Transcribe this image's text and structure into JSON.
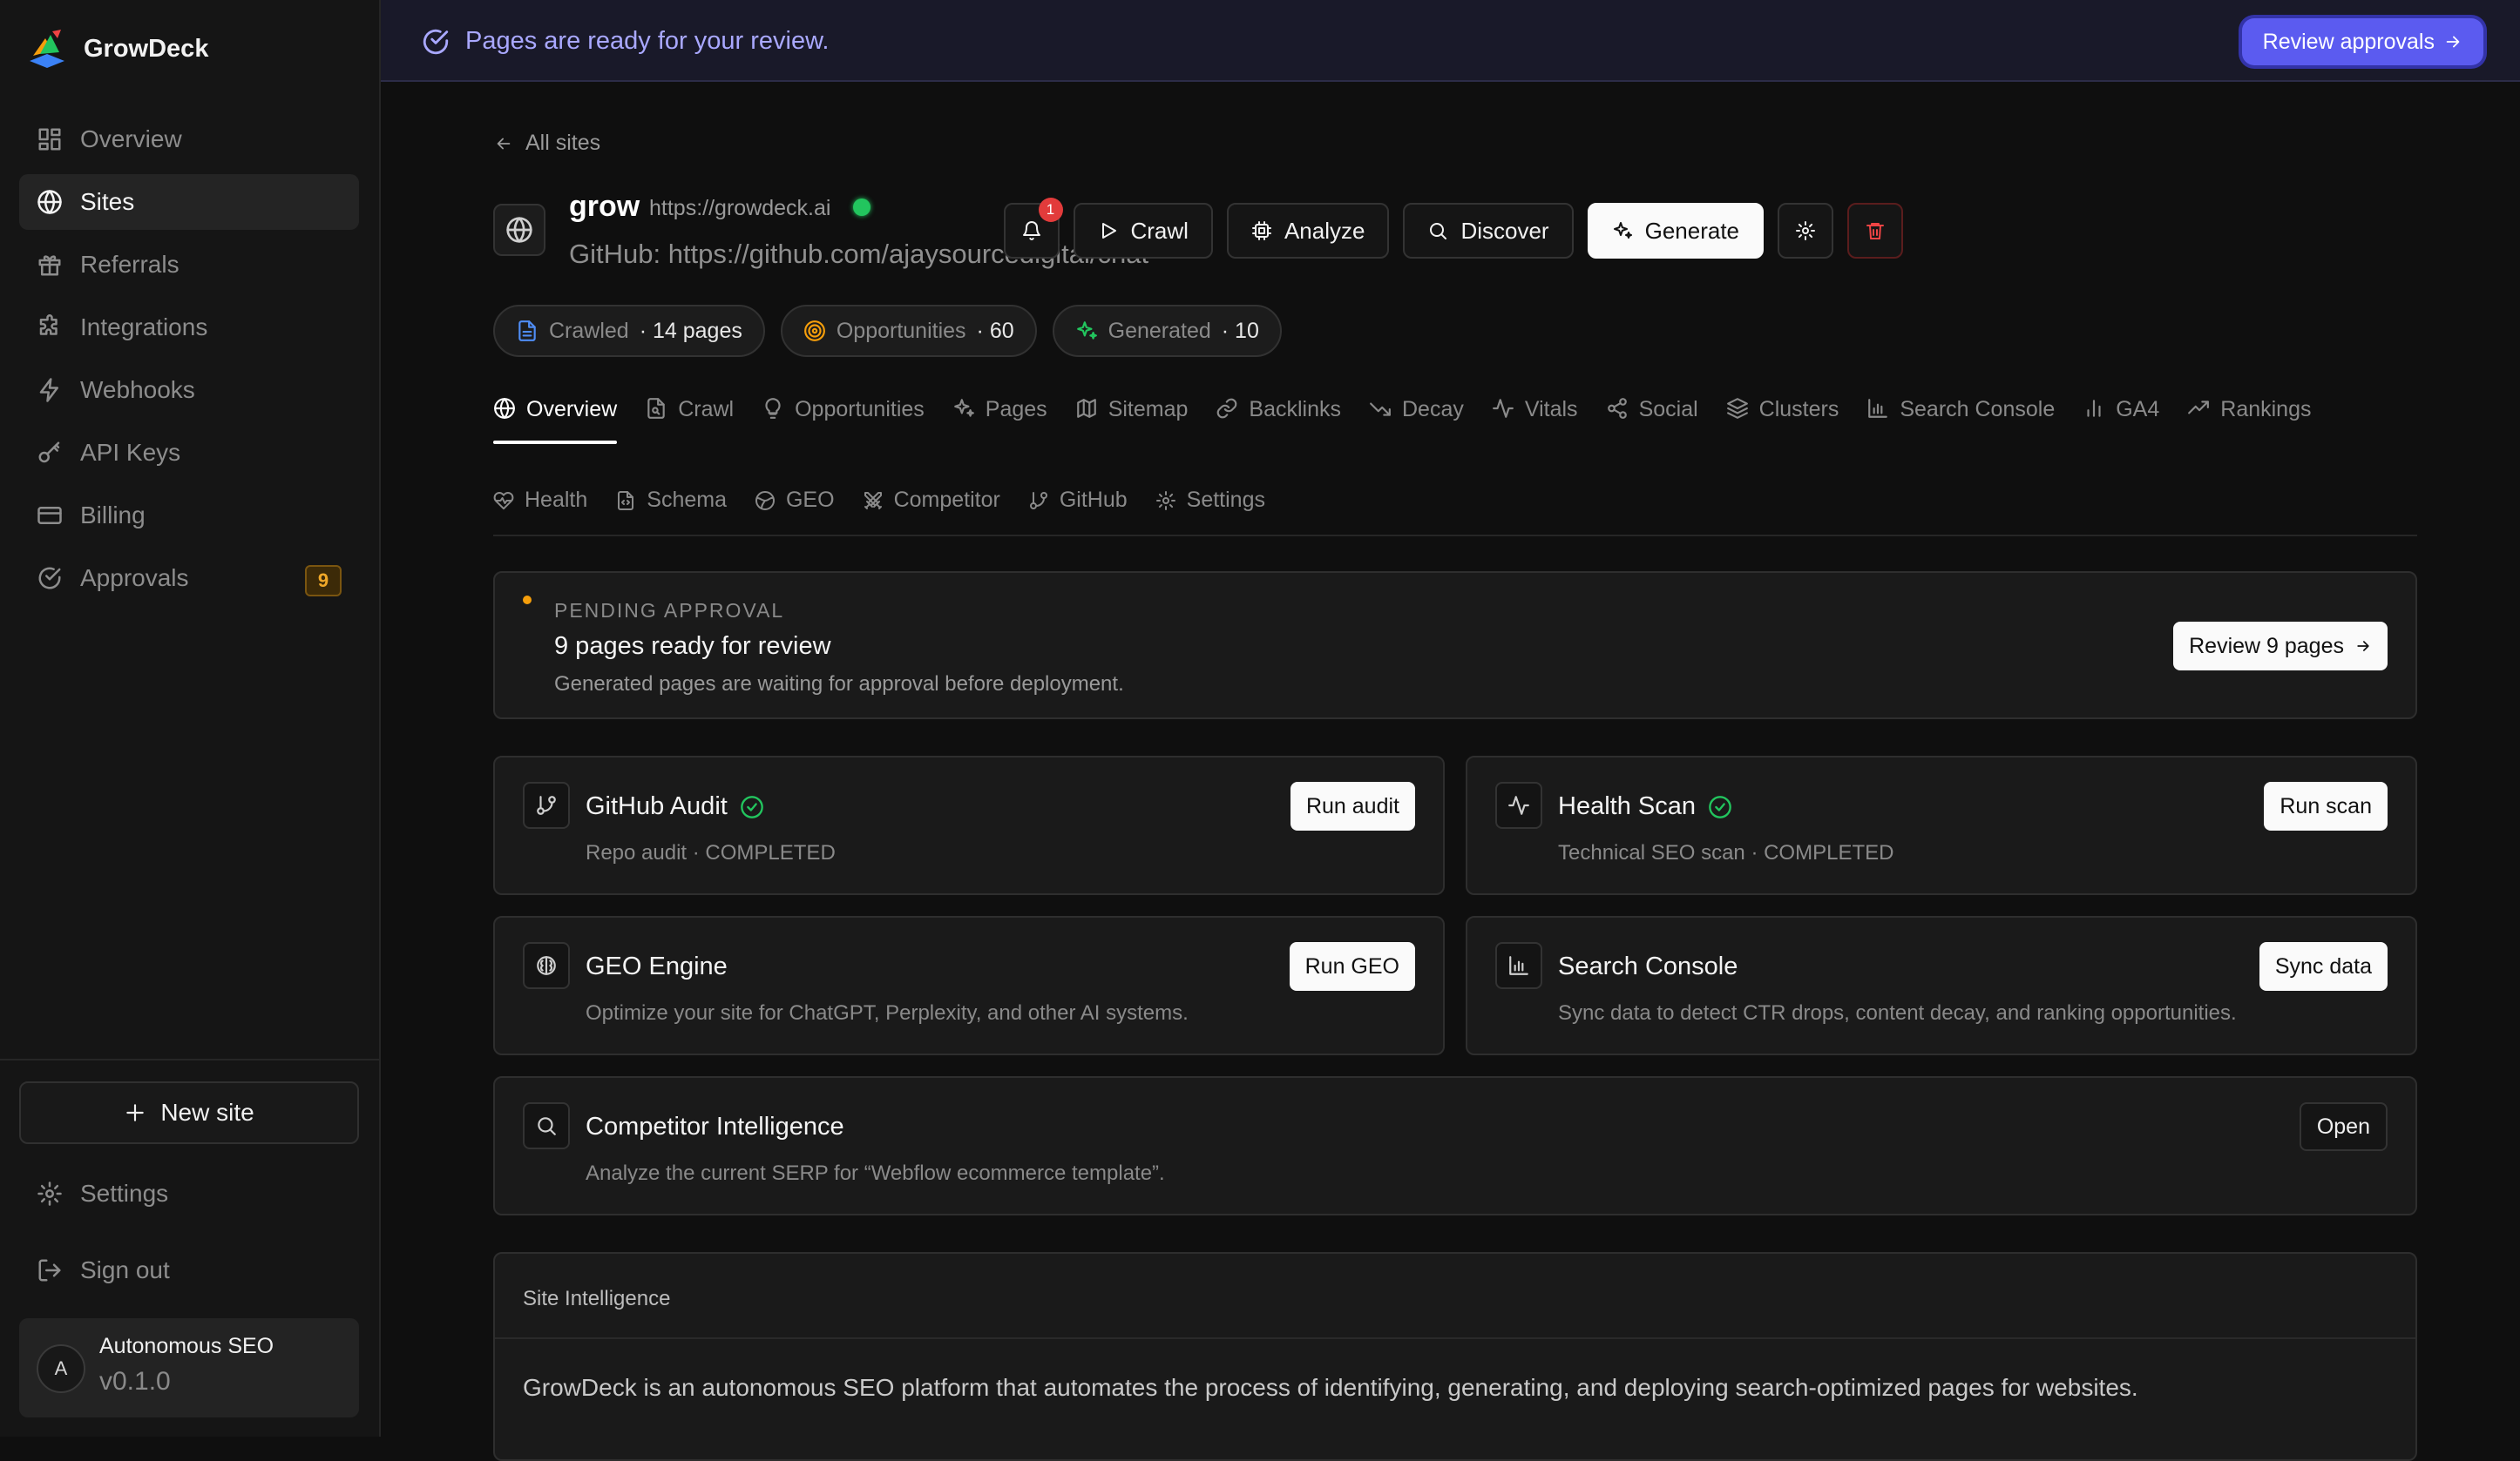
{
  "app": {
    "name": "GrowDeck"
  },
  "sidebar": {
    "items": [
      {
        "label": "Overview",
        "icon": "layout-dashboard-icon"
      },
      {
        "label": "Sites",
        "icon": "globe-icon"
      },
      {
        "label": "Referrals",
        "icon": "gift-icon"
      },
      {
        "label": "Integrations",
        "icon": "puzzle-icon"
      },
      {
        "label": "Webhooks",
        "icon": "zap-icon"
      },
      {
        "label": "API Keys",
        "icon": "key-icon"
      },
      {
        "label": "Billing",
        "icon": "credit-card-icon"
      },
      {
        "label": "Approvals",
        "icon": "check-circle-icon",
        "badge": "9"
      }
    ],
    "active": "Sites",
    "new_site": "New site",
    "settings": "Settings",
    "sign_out": "Sign out",
    "user": {
      "initial": "A",
      "name": "Autonomous SEO",
      "version": "v0.1.0"
    }
  },
  "banner": {
    "text": "Pages are ready for your review.",
    "button": "Review approvals"
  },
  "site": {
    "back": "All sites",
    "name": "grow",
    "url": "https://growdeck.ai",
    "github": "GitHub: https://github.com/ajaysourcedigital/chat",
    "notifications": "1",
    "actions": {
      "crawl": "Crawl",
      "analyze": "Analyze",
      "discover": "Discover",
      "generate": "Generate"
    },
    "stats": [
      {
        "label": "Crawled",
        "value": "· 14 pages"
      },
      {
        "label": "Opportunities",
        "value": "· 60"
      },
      {
        "label": "Generated",
        "value": "· 10"
      }
    ]
  },
  "tabs": {
    "primary": [
      "Overview",
      "Crawl",
      "Opportunities",
      "Pages",
      "Sitemap",
      "Backlinks",
      "Decay",
      "Vitals",
      "Social",
      "Clusters",
      "Search Console",
      "GA4",
      "Rankings"
    ],
    "secondary": [
      "Health",
      "Schema",
      "GEO",
      "Competitor",
      "GitHub",
      "Settings"
    ],
    "active": "Overview"
  },
  "pending": {
    "kicker": "PENDING APPROVAL",
    "title": "9 pages ready for review",
    "description": "Generated pages are waiting for approval before deployment.",
    "button": "Review 9 pages"
  },
  "tools": {
    "github_audit": {
      "title": "GitHub Audit",
      "desc": "Repo audit · COMPLETED",
      "button": "Run audit"
    },
    "health_scan": {
      "title": "Health Scan",
      "desc": "Technical SEO scan · COMPLETED",
      "button": "Run scan"
    },
    "geo_engine": {
      "title": "GEO Engine",
      "desc": "Optimize your site for ChatGPT, Perplexity, and other AI systems.",
      "button": "Run GEO"
    },
    "search_console": {
      "title": "Search Console",
      "desc": "Sync data to detect CTR drops, content decay, and ranking opportunities.",
      "button": "Sync data"
    },
    "competitor": {
      "title": "Competitor Intelligence",
      "desc": "Analyze the current SERP for “Webflow ecommerce template”.",
      "button": "Open"
    }
  },
  "intelligence": {
    "heading": "Site Intelligence",
    "text": "GrowDeck is an autonomous SEO platform that automates the process of identifying, generating, and deploying search-optimized pages for websites."
  },
  "colors": {
    "accent": "#5b5bf0",
    "success": "#22c55e",
    "warning": "#f59e0b",
    "danger": "#ef4444"
  }
}
